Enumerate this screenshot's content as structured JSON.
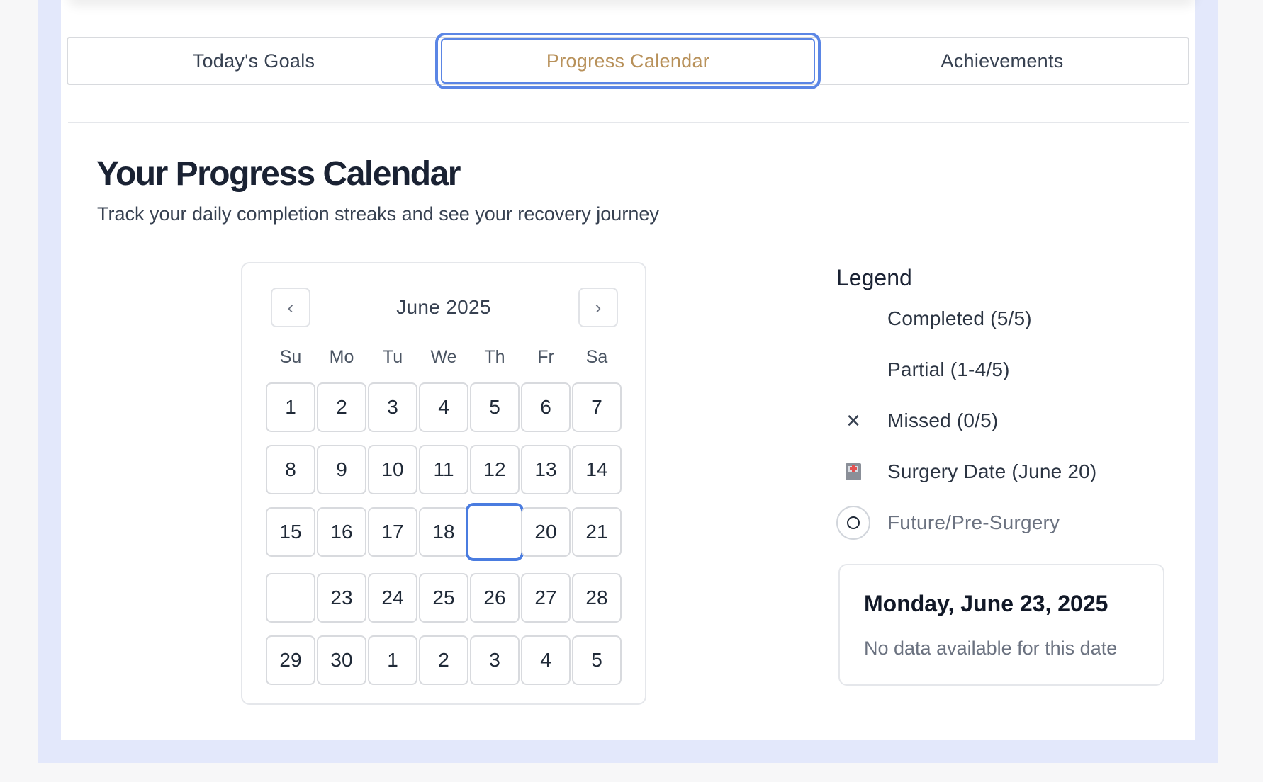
{
  "tabs": [
    {
      "label": "Today's Goals",
      "active": false
    },
    {
      "label": "Progress Calendar",
      "active": true
    },
    {
      "label": "Achievements",
      "active": false
    }
  ],
  "colors": {
    "active_tab_text": "#b8915a",
    "focus_ring": "#5b86e5",
    "backdrop": "#e3e8fb"
  },
  "page": {
    "title": "Your Progress Calendar",
    "subtitle": "Track your daily completion streaks and see your recovery journey"
  },
  "calendar": {
    "month_label": "June 2025",
    "prev_icon": "chevron-left-icon",
    "next_icon": "chevron-right-icon",
    "weekdays": [
      "Su",
      "Mo",
      "Tu",
      "We",
      "Th",
      "Fr",
      "Sa"
    ],
    "days": [
      "1",
      "2",
      "3",
      "4",
      "5",
      "6",
      "7",
      "8",
      "9",
      "10",
      "11",
      "12",
      "13",
      "14",
      "15",
      "16",
      "17",
      "18",
      "",
      "20",
      "21",
      "",
      "23",
      "24",
      "25",
      "26",
      "27",
      "28",
      "29",
      "30",
      "1",
      "2",
      "3",
      "4",
      "5"
    ],
    "focused_index": 18
  },
  "legend": {
    "title": "Legend",
    "items": [
      {
        "icon": "",
        "label": "Completed (5/5)"
      },
      {
        "icon": "",
        "label": "Partial (1-4/5)"
      },
      {
        "icon": "✕",
        "label": "Missed (0/5)"
      },
      {
        "icon": "hospital-icon",
        "label": "Surgery Date (June 20)"
      },
      {
        "icon": "circle-icon",
        "label": "Future/Pre-Surgery"
      }
    ]
  },
  "detail": {
    "date": "Monday, June 23, 2025",
    "note": "No data available for this date"
  }
}
